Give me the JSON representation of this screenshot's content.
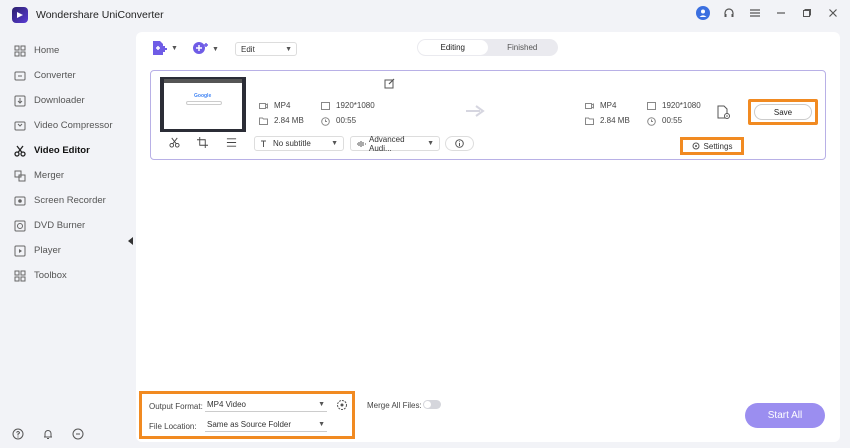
{
  "app": {
    "title": "Wondershare UniConverter"
  },
  "sidebar": {
    "items": [
      {
        "label": "Home",
        "icon": "home-icon"
      },
      {
        "label": "Converter",
        "icon": "converter-icon"
      },
      {
        "label": "Downloader",
        "icon": "download-icon"
      },
      {
        "label": "Video Compressor",
        "icon": "compress-icon"
      },
      {
        "label": "Video Editor",
        "icon": "scissors-icon",
        "active": true
      },
      {
        "label": "Merger",
        "icon": "merge-icon"
      },
      {
        "label": "Screen Recorder",
        "icon": "record-icon"
      },
      {
        "label": "DVD Burner",
        "icon": "disc-icon"
      },
      {
        "label": "Player",
        "icon": "play-icon"
      },
      {
        "label": "Toolbox",
        "icon": "grid-icon"
      }
    ]
  },
  "toolbar": {
    "mode": "Edit"
  },
  "tabs": {
    "editing": "Editing",
    "finished": "Finished"
  },
  "file": {
    "thumbnail_text": "Google",
    "source": {
      "format": "MP4",
      "resolution": "1920*1080",
      "size": "2.84 MB",
      "duration": "00:55"
    },
    "target": {
      "format": "MP4",
      "resolution": "1920*1080",
      "size": "2.84 MB",
      "duration": "00:55"
    },
    "subtitle": "No subtitle",
    "audio": "Advanced Audi...",
    "save_label": "Save",
    "settings_label": "Settings"
  },
  "bottom": {
    "output_format_label": "Output Format:",
    "output_format_value": "MP4 Video",
    "file_location_label": "File Location:",
    "file_location_value": "Same as Source Folder",
    "merge_label": "Merge All Files:",
    "start_label": "Start All"
  },
  "colors": {
    "accent": "#9b8ef0",
    "highlight": "#f18a21"
  }
}
